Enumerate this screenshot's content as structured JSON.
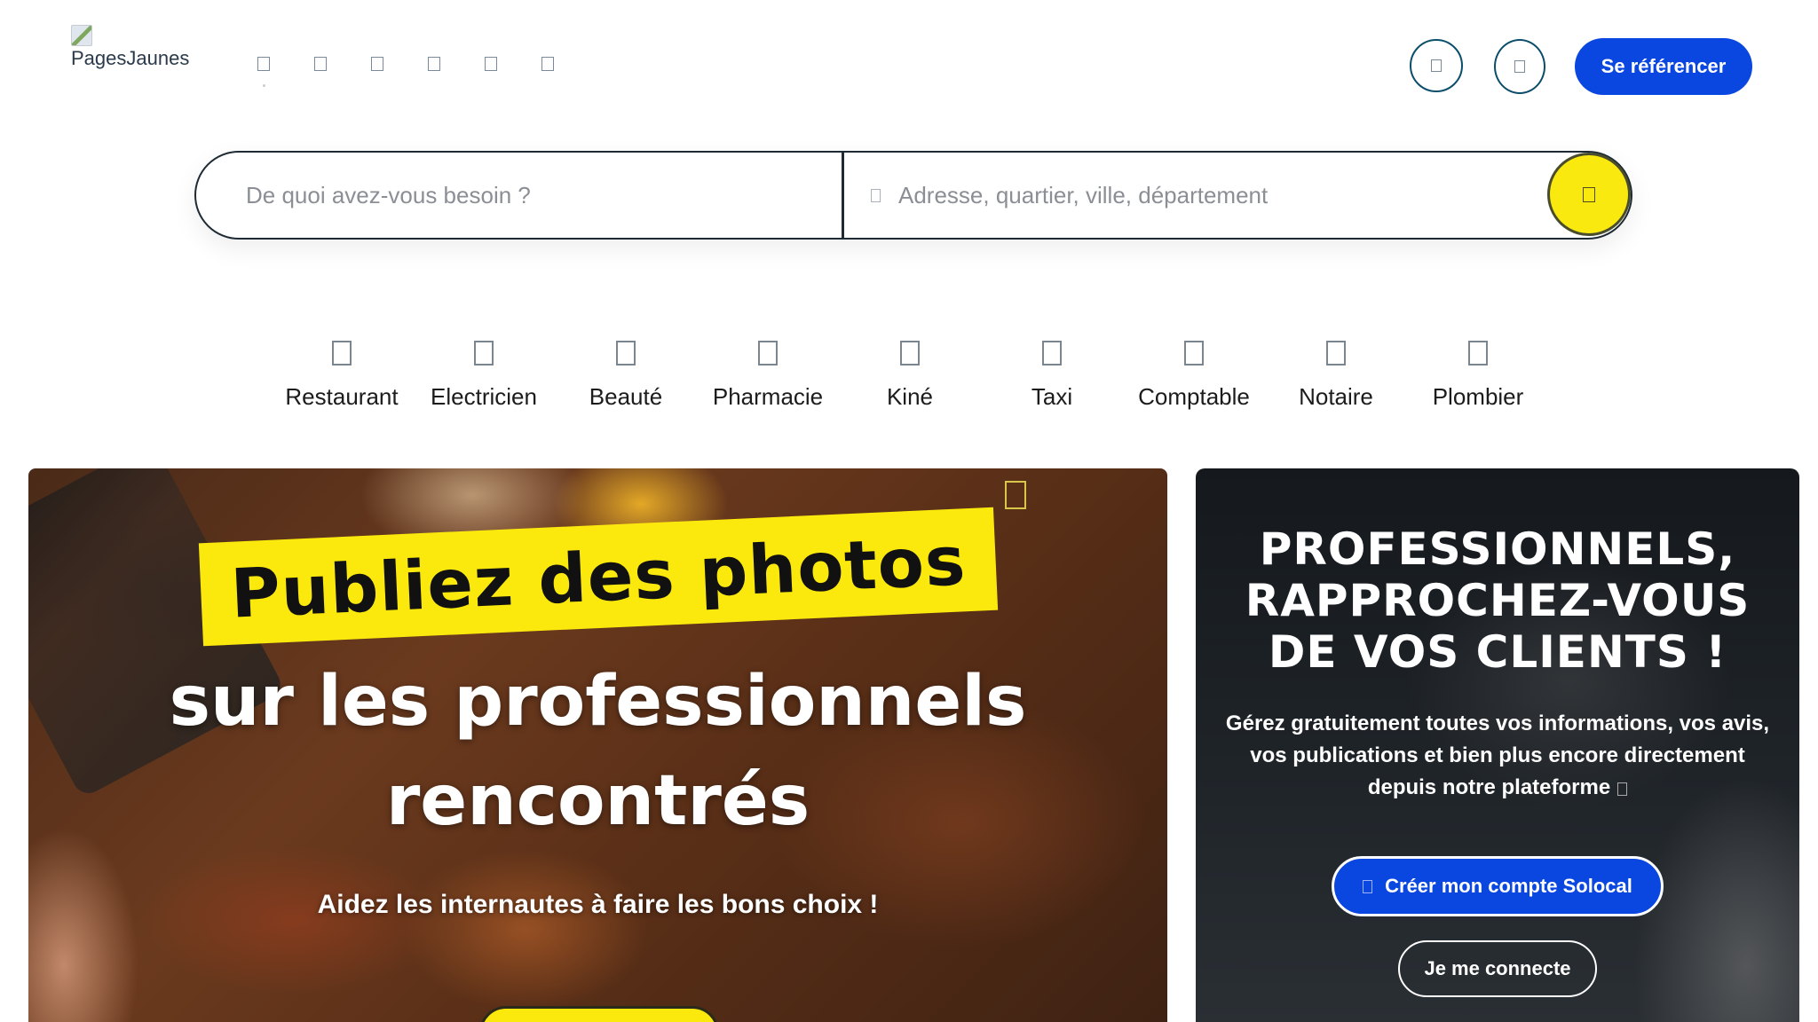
{
  "header": {
    "logo_text": "PagesJaunes",
    "nav_icons": [
      "nav-icon-1",
      "nav-icon-2",
      "nav-icon-3",
      "nav-icon-4",
      "nav-icon-5",
      "nav-icon-6"
    ],
    "cta_label": "Se référencer"
  },
  "search": {
    "what_placeholder": "De quoi avez-vous besoin ?",
    "where_placeholder": "Adresse, quartier, ville, département"
  },
  "categories": [
    {
      "label": "Restaurant",
      "icon": "restaurant-icon"
    },
    {
      "label": "Electricien",
      "icon": "electrician-icon"
    },
    {
      "label": "Beauté",
      "icon": "beauty-icon"
    },
    {
      "label": "Pharmacie",
      "icon": "pharmacy-icon"
    },
    {
      "label": "Kiné",
      "icon": "physio-icon"
    },
    {
      "label": "Taxi",
      "icon": "taxi-icon"
    },
    {
      "label": "Comptable",
      "icon": "accountant-icon"
    },
    {
      "label": "Notaire",
      "icon": "notary-icon"
    },
    {
      "label": "Plombier",
      "icon": "plumber-icon"
    }
  ],
  "promo_left": {
    "highlight": "Publiez des photos",
    "line1": "sur les professionnels",
    "line2": "rencontrés",
    "tagline": "Aidez les internautes à faire les bons choix !"
  },
  "promo_right": {
    "title_line1": "PROFESSIONNELS,",
    "title_line2": "RAPPROCHEZ-VOUS",
    "title_line3": "DE VOS CLIENTS !",
    "desc_line1": "Gérez gratuitement toutes vos informations, vos avis,",
    "desc_line2": "vos publications et bien plus encore directement",
    "desc_line3": "depuis notre plateforme",
    "create_label": "Créer mon compte Solocal",
    "login_label": "Je me connecte"
  },
  "colors": {
    "brand_blue": "#0a47e0",
    "brand_yellow": "#fbe90d",
    "dark": "#1e2b35"
  }
}
